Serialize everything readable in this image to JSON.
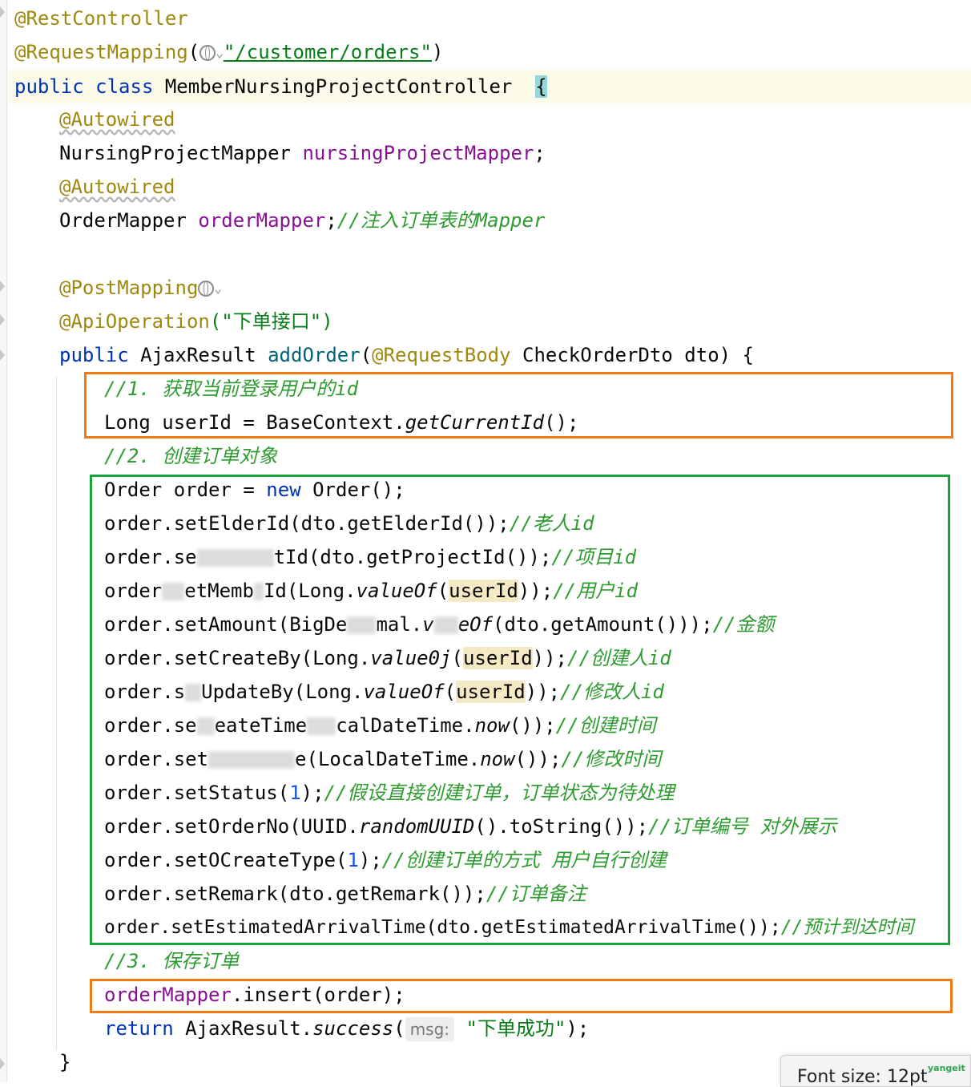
{
  "editor": {
    "line1": {
      "annotation": "@RestController"
    },
    "line2": {
      "annotation": "@RequestMapping",
      "open": "(",
      "url": "\"/customer/orders\"",
      "close": ")"
    },
    "line3": {
      "public": "public",
      "class": "class",
      "name": "MemberNursingProjectController",
      "brace": "{"
    },
    "line4": {
      "annotation": "@Autowired"
    },
    "line5": {
      "type": "NursingProjectMapper",
      "field": "nursingProjectMapper",
      "semi": ";"
    },
    "line6": {
      "annotation": "@Autowired"
    },
    "line7": {
      "type": "OrderMapper",
      "field": "orderMapper",
      "semi": ";",
      "comment": "//注入订单表的Mapper"
    },
    "line9": {
      "annotation": "@PostMapping"
    },
    "line10": {
      "annotation": "@ApiOperation",
      "args": "(\"下单接口\")"
    },
    "line11": {
      "public": "public",
      "ret": "AjaxResult",
      "method": "addOrder",
      "paren": "(",
      "param_ann": "@RequestBody",
      "rest": "CheckOrderDto dto) {"
    },
    "line12": {
      "comment": "//1. 获取当前登录用户的id"
    },
    "line13": {
      "pre": "Long userId = BaseContext.",
      "call": "getCurrentId",
      "post": "();"
    },
    "line14": {
      "comment": "//2. 创建订单对象"
    },
    "line15": {
      "pre": "Order order = ",
      "new": "new",
      "post": " Order();"
    },
    "line16": {
      "code": "order.setElderId(dto.getElderId());",
      "comment": "//老人id"
    },
    "line17": {
      "pre": "order.se",
      "post": "tId(dto.getProjectId());",
      "comment": "//项目id"
    },
    "line18": {
      "pre": "order",
      "mid1": "etMemb",
      "mid2": "Id(Long.",
      "ital": "valueOf",
      "paren": "(",
      "var": "userId",
      "post": "));",
      "comment": "//用户id"
    },
    "line19": {
      "pre": "order.setAmount(BigDe",
      "mid": "mal.",
      "ital1": "v",
      "ital2": "eOf",
      "post": "(dto.getAmount()));",
      "comment": "//金额"
    },
    "line20": {
      "pre": "order.setCreateBy(Long.",
      "ital": "value0j",
      "paren": "(",
      "var": "userId",
      "post": "));",
      "comment": "//创建人id"
    },
    "line21": {
      "pre": "order.s",
      "mid": "UpdateBy(Long.",
      "ital": "valueOf",
      "paren": "(",
      "var": "userId",
      "post": "));",
      "comment": "//修改人id"
    },
    "line22": {
      "pre": "order.se",
      "mid": "eateTime",
      "post1": "calDateTime.",
      "ital": "now",
      "post2": "());",
      "comment": "//创建时间"
    },
    "line23": {
      "pre": "order.set",
      "mid": "e(LocalDateTime.",
      "ital": "now",
      "post": "());",
      "comment": "//修改时间"
    },
    "line24": {
      "pre": "order.setStatus(",
      "num": "1",
      "post": ");",
      "comment": "//假设直接创建订单，订单状态为待处理"
    },
    "line25": {
      "pre": "order.setOrderNo(UUID.",
      "ital": "randomUUID",
      "post": "().toString());",
      "comment": "//订单编号 对外展示"
    },
    "line26": {
      "pre": "order.setOCreateType(",
      "num": "1",
      "post": ");",
      "comment": "//创建订单的方式 用户自行创建"
    },
    "line27": {
      "code": "order.setRemark(dto.getRemark());",
      "comment": "//订单备注"
    },
    "line28": {
      "code": "order.setEstimatedArrivalTime(dto.getEstimatedArrivalTime());",
      "comment": "//预计到达时间"
    },
    "line29": {
      "comment": "//3. 保存订单"
    },
    "line30": {
      "field": "orderMapper",
      "post": ".insert(order);"
    },
    "line31": {
      "ret": "return",
      "pre": " AjaxResult.",
      "ital": "success",
      "paren": "(",
      "hint": "msg:",
      "str": "\"下单成功\"",
      "post": ");"
    },
    "line32": {
      "brace": "}"
    }
  },
  "popup": {
    "text": "Font size: 12pt"
  },
  "watermark": {
    "text": "yangeit"
  },
  "colors": {
    "orange_box": "#f07a16",
    "green_box": "#1aa33a",
    "keyword": "#0033b3",
    "annotation": "#9e880d",
    "field": "#871094",
    "comment": "#2e9c30"
  }
}
